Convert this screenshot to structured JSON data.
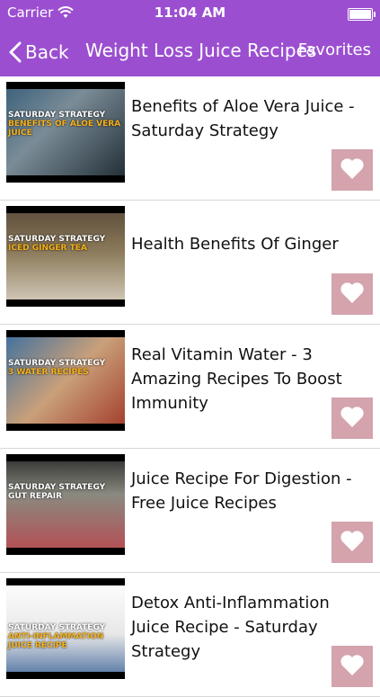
{
  "status_bar": {
    "carrier": "Carrier",
    "time": "11:04 AM",
    "icons": [
      "wifi-icon",
      "battery-icon"
    ]
  },
  "nav": {
    "back_label": "Back",
    "title": "Weight Loss Juice Recipes",
    "favorites_label": "Favorites",
    "back_icon": "chevron-left-icon"
  },
  "colors": {
    "bar": "#9b4fd0",
    "favorite_button": "#d4a3ab",
    "divider": "#d8d8d8"
  },
  "items": [
    {
      "title": "Benefits of Aloe Vera Juice - Saturday Strategy",
      "thumb_text": "SATURDAY STRATEGY",
      "thumb_subtext": "BENEFITS OF ALOE VERA JUICE",
      "favorite_icon": "heart-icon"
    },
    {
      "title": "Health Benefits Of Ginger",
      "thumb_text": "SATURDAY STRATEGY",
      "thumb_subtext": "ICED GINGER TEA",
      "favorite_icon": "heart-icon"
    },
    {
      "title": "Real Vitamin Water - 3 Amazing Recipes To Boost Immunity",
      "thumb_text": "SATURDAY STRATEGY",
      "thumb_subtext": "3 WATER RECIPES",
      "favorite_icon": "heart-icon"
    },
    {
      "title": "Juice Recipe For Digestion - Free Juice Recipes",
      "thumb_text": "SATURDAY STRATEGY",
      "thumb_subtext": "GUT REPAIR",
      "favorite_icon": "heart-icon"
    },
    {
      "title": "Detox Anti-Inflammation Juice Recipe - Saturday Strategy",
      "thumb_text": "SATURDAY STRATEGY",
      "thumb_subtext": "ANTI-INFLAMMATION JUICE RECIPE",
      "favorite_icon": "heart-icon"
    }
  ]
}
